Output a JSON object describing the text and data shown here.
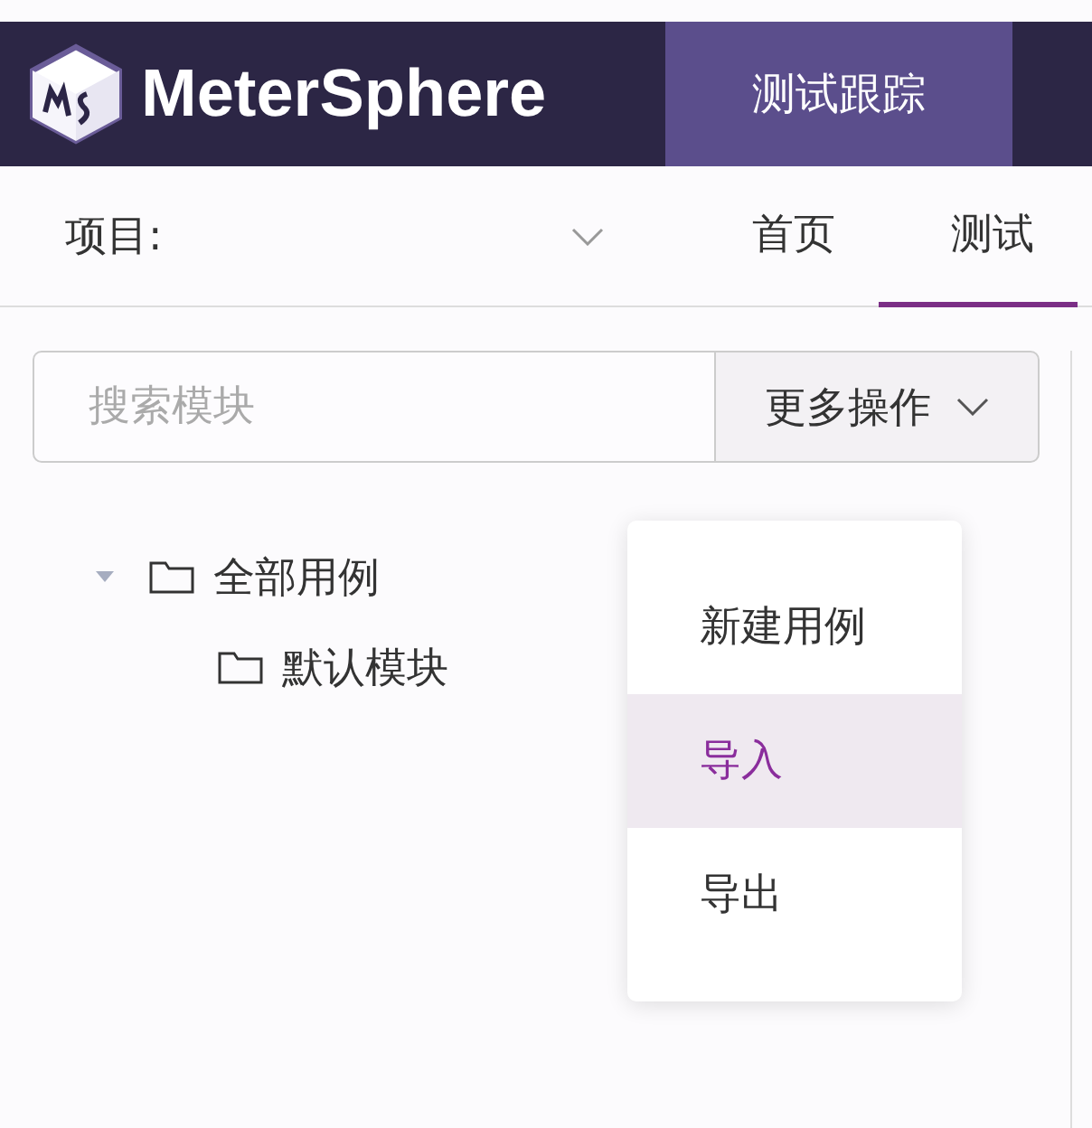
{
  "header": {
    "logo": "MeterSphere",
    "tabs": [
      {
        "label": "测试跟踪",
        "selected": true
      }
    ]
  },
  "subnav": {
    "project_label": "项目:",
    "items": [
      {
        "label": "首页",
        "selected": false
      },
      {
        "label": "测试",
        "selected": true
      }
    ]
  },
  "search": {
    "placeholder": "搜索模块"
  },
  "more_button": {
    "label": "更多操作"
  },
  "tree": [
    {
      "label": "全部用例",
      "expanded": true,
      "children": [
        {
          "label": "默认模块"
        }
      ]
    }
  ],
  "menu": [
    {
      "label": "新建用例",
      "highlighted": false
    },
    {
      "label": "导入",
      "highlighted": true
    },
    {
      "label": "导出",
      "highlighted": false
    }
  ]
}
